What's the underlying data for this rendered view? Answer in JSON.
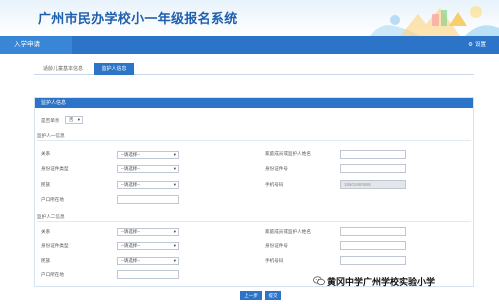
{
  "header": {
    "title": "广州市民办学校小一年级报名系统"
  },
  "navbar": {
    "title": "入学申请",
    "settings_label": "设置"
  },
  "tabs": [
    {
      "label": "适龄儿童基本信息",
      "active": false
    },
    {
      "label": "监护人信息",
      "active": true
    }
  ],
  "panel": {
    "title": "监护人信息",
    "single_parent_label": "是否单亲",
    "single_parent_value": "否",
    "guardian1": {
      "section_title": "监护人一信息",
      "relation_label": "关系",
      "relation_value": "--请选择--",
      "id_type_label": "身份证件类型",
      "id_type_value": "--请选择--",
      "ethnicity_label": "民族",
      "ethnicity_value": "--请选择--",
      "hukou_label": "户口所在地",
      "is_family_guardian_label": "家庭成员或监护人姓名",
      "id_number_label": "身份证件号",
      "phone_label": "手机号码",
      "phone_value": "18601960695"
    },
    "guardian2": {
      "section_title": "监护人二信息",
      "relation_label": "关系",
      "relation_value": "--请选择--",
      "id_type_label": "身份证件类型",
      "id_type_value": "--请选择--",
      "ethnicity_label": "民族",
      "ethnicity_value": "--请选择--",
      "hukou_label": "户口所在地",
      "is_family_guardian_label": "家庭成员或监护人姓名",
      "id_number_label": "身份证件号",
      "phone_label": "手机号码"
    }
  },
  "buttons": {
    "prev": "上一步",
    "submit": "提交"
  },
  "watermark": {
    "text": "黄冈中学广州学校实验小学"
  },
  "colors": {
    "primary": "#2b74c8",
    "title_blue": "#1e5fae"
  },
  "icons": {
    "settings": "gear-icon",
    "watermark": "wechat-icon"
  }
}
